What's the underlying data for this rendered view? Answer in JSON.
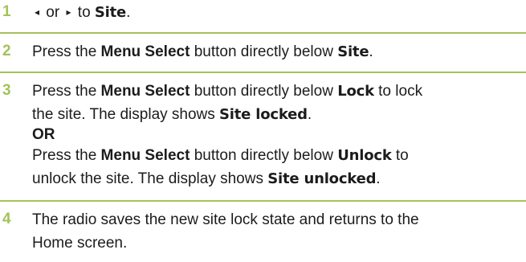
{
  "steps": [
    {
      "number": "1",
      "line1": {
        "left_arrow": "◂",
        "or_text": " or ",
        "right_arrow": "▸",
        "to_text": " to ",
        "display": "Site",
        "end": "."
      }
    },
    {
      "number": "2",
      "line1": {
        "pre": "Press the ",
        "bold": "Menu Select",
        "mid": " button directly below ",
        "display": "Site",
        "end": "."
      }
    },
    {
      "number": "3",
      "line1": {
        "pre": "Press the ",
        "bold": "Menu Select",
        "mid": " button directly below ",
        "display": "Lock",
        "end": " to lock"
      },
      "line2": {
        "pre": "the site. The display shows ",
        "display": "Site locked",
        "end": "."
      },
      "or": "OR",
      "line4": {
        "pre": "Press the ",
        "bold": "Menu Select",
        "mid": " button directly below ",
        "display": "Unlock",
        "end": " to"
      },
      "line5": {
        "pre": "unlock the site. The display shows ",
        "display": "Site unlocked",
        "end": "."
      }
    },
    {
      "number": "4",
      "line1": "The radio saves the new site lock state and returns to the",
      "line2": "Home screen."
    }
  ],
  "colors": {
    "accent": "#a4c25a",
    "text": "#1c1c1c"
  }
}
